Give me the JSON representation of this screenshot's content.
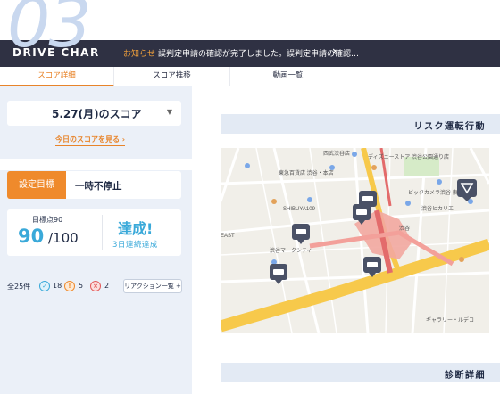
{
  "header": {
    "big_number": "03",
    "brand": "DRIVE CHAR",
    "notice_label": "お知らせ",
    "notice_text": "誤判定申請の確認が完了しました。誤判定申請の確認…",
    "notice_arrow": "›"
  },
  "tabs": [
    {
      "label": "スコア詳細",
      "active": true
    },
    {
      "label": "スコア推移",
      "active": false
    },
    {
      "label": "動画一覧",
      "active": false
    }
  ],
  "left": {
    "date_label": "5.27(月)のスコア",
    "date_caret": "▼",
    "today_link": "今日のスコアを見る ›",
    "goal_tag": "設定目標",
    "goal_value": "一時不停止",
    "score_label": "目標点90",
    "score_value": "90",
    "score_max": "/100",
    "achieved": "達成!",
    "achieved_sub": "3日連続達成",
    "total": "全25件",
    "counts": [
      {
        "icon": "circle-check-icon",
        "count": "18",
        "color": "#3aa9d9"
      },
      {
        "icon": "triangle-warn-icon",
        "count": "5",
        "color": "#ef8a2c"
      },
      {
        "icon": "x-mark-icon",
        "count": "2",
        "color": "#e35a5a"
      }
    ],
    "reaction_button": "リアクション一覧 +"
  },
  "right": {
    "risk_title": "リスク運転行動",
    "diagnosis_title": "診断詳細",
    "map_labels": {
      "nishi_shibuya": "西武渋谷店",
      "disney": "ディズニーストア 渋谷公園通り店",
      "tokyu": "東急百貨店 渋谷・本店",
      "shibuya109": "SHIBUYA109",
      "bic": "ビックカメラ渋谷 東口店",
      "hikarie": "渋谷ヒカリエ",
      "marksity": "渋谷マークシティ",
      "east": "EAST",
      "shibuya": "渋谷",
      "gallery": "ギャラリー・ルデコ"
    }
  },
  "colors": {
    "accent": "#ef8a2c",
    "primary": "#3aa9d9",
    "header_bg": "#2f3143",
    "panel_bg": "#ebf0f8"
  }
}
